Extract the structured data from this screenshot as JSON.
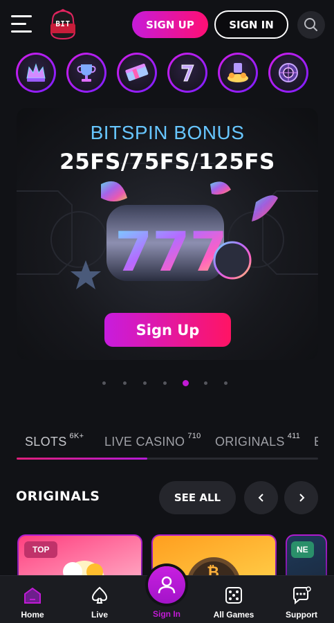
{
  "header": {
    "logo_text": "BIT",
    "signup_label": "SIGN UP",
    "signin_label": "SIGN IN"
  },
  "categories": [
    {
      "icon": "crown-icon"
    },
    {
      "icon": "trophy-icon"
    },
    {
      "icon": "cash-stack-icon"
    },
    {
      "icon": "seven-icon"
    },
    {
      "icon": "gold-pile-icon"
    },
    {
      "icon": "roulette-icon"
    }
  ],
  "banner": {
    "title": "BITSPIN BONUS",
    "subtitle": "25FS/75FS/125FS",
    "button_label": "Sign Up",
    "slides_count": 7,
    "active_slide": 5
  },
  "tabs": [
    {
      "label": "SLOTS",
      "count": "6K+"
    },
    {
      "label": "LIVE CASINO",
      "count": "710"
    },
    {
      "label": "ORIGINALS",
      "count": "411"
    },
    {
      "label": "B",
      "count": ""
    }
  ],
  "section": {
    "title": "ORIGINALS",
    "see_all_label": "SEE ALL"
  },
  "cards": [
    {
      "badge": "TOP",
      "badge_color": "#c0326a"
    },
    {
      "badge": "",
      "badge_color": ""
    },
    {
      "badge": "NE",
      "badge_color": "#2a8f6a"
    }
  ],
  "bottom_nav": {
    "home": "Home",
    "live": "Live",
    "signin": "Sign In",
    "all_games": "All Games",
    "support": "Support"
  },
  "colors": {
    "accent": "#c21ad6",
    "accent_pink": "#ff0f73",
    "background": "#111216",
    "banner_title": "#67c6ff"
  }
}
